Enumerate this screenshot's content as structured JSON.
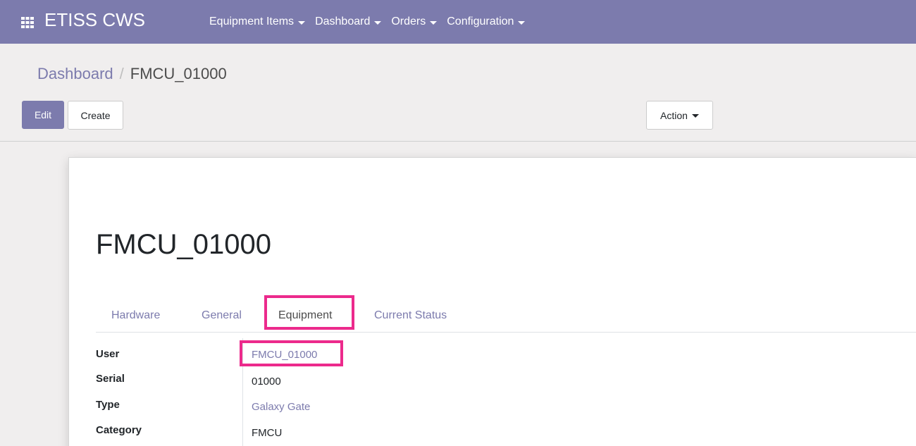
{
  "navbar": {
    "brand": "ETISS CWS",
    "apps_icon": "grid-apps-icon",
    "menu": [
      {
        "label": "Equipment Items"
      },
      {
        "label": "Dashboard"
      },
      {
        "label": "Orders"
      },
      {
        "label": "Configuration"
      }
    ],
    "bg_color": "#7c7bad"
  },
  "breadcrumb": {
    "parent": "Dashboard",
    "separator": "/",
    "current": "FMCU_01000"
  },
  "toolbar": {
    "edit_label": "Edit",
    "create_label": "Create",
    "action_label": "Action"
  },
  "record": {
    "title": "FMCU_01000",
    "tabs": [
      {
        "label": "Hardware"
      },
      {
        "label": "General"
      },
      {
        "label": "Equipment",
        "active": true
      },
      {
        "label": "Current Status"
      }
    ],
    "fields": [
      {
        "label": "User",
        "value": "FMCU_01000",
        "link": true
      },
      {
        "label": "Serial",
        "value": "01000",
        "link": false
      },
      {
        "label": "Type",
        "value": "Galaxy Gate",
        "link": true
      },
      {
        "label": "Category",
        "value": "FMCU",
        "link": false
      }
    ]
  },
  "annotations": {
    "highlight_color": "#ec2a8c"
  }
}
